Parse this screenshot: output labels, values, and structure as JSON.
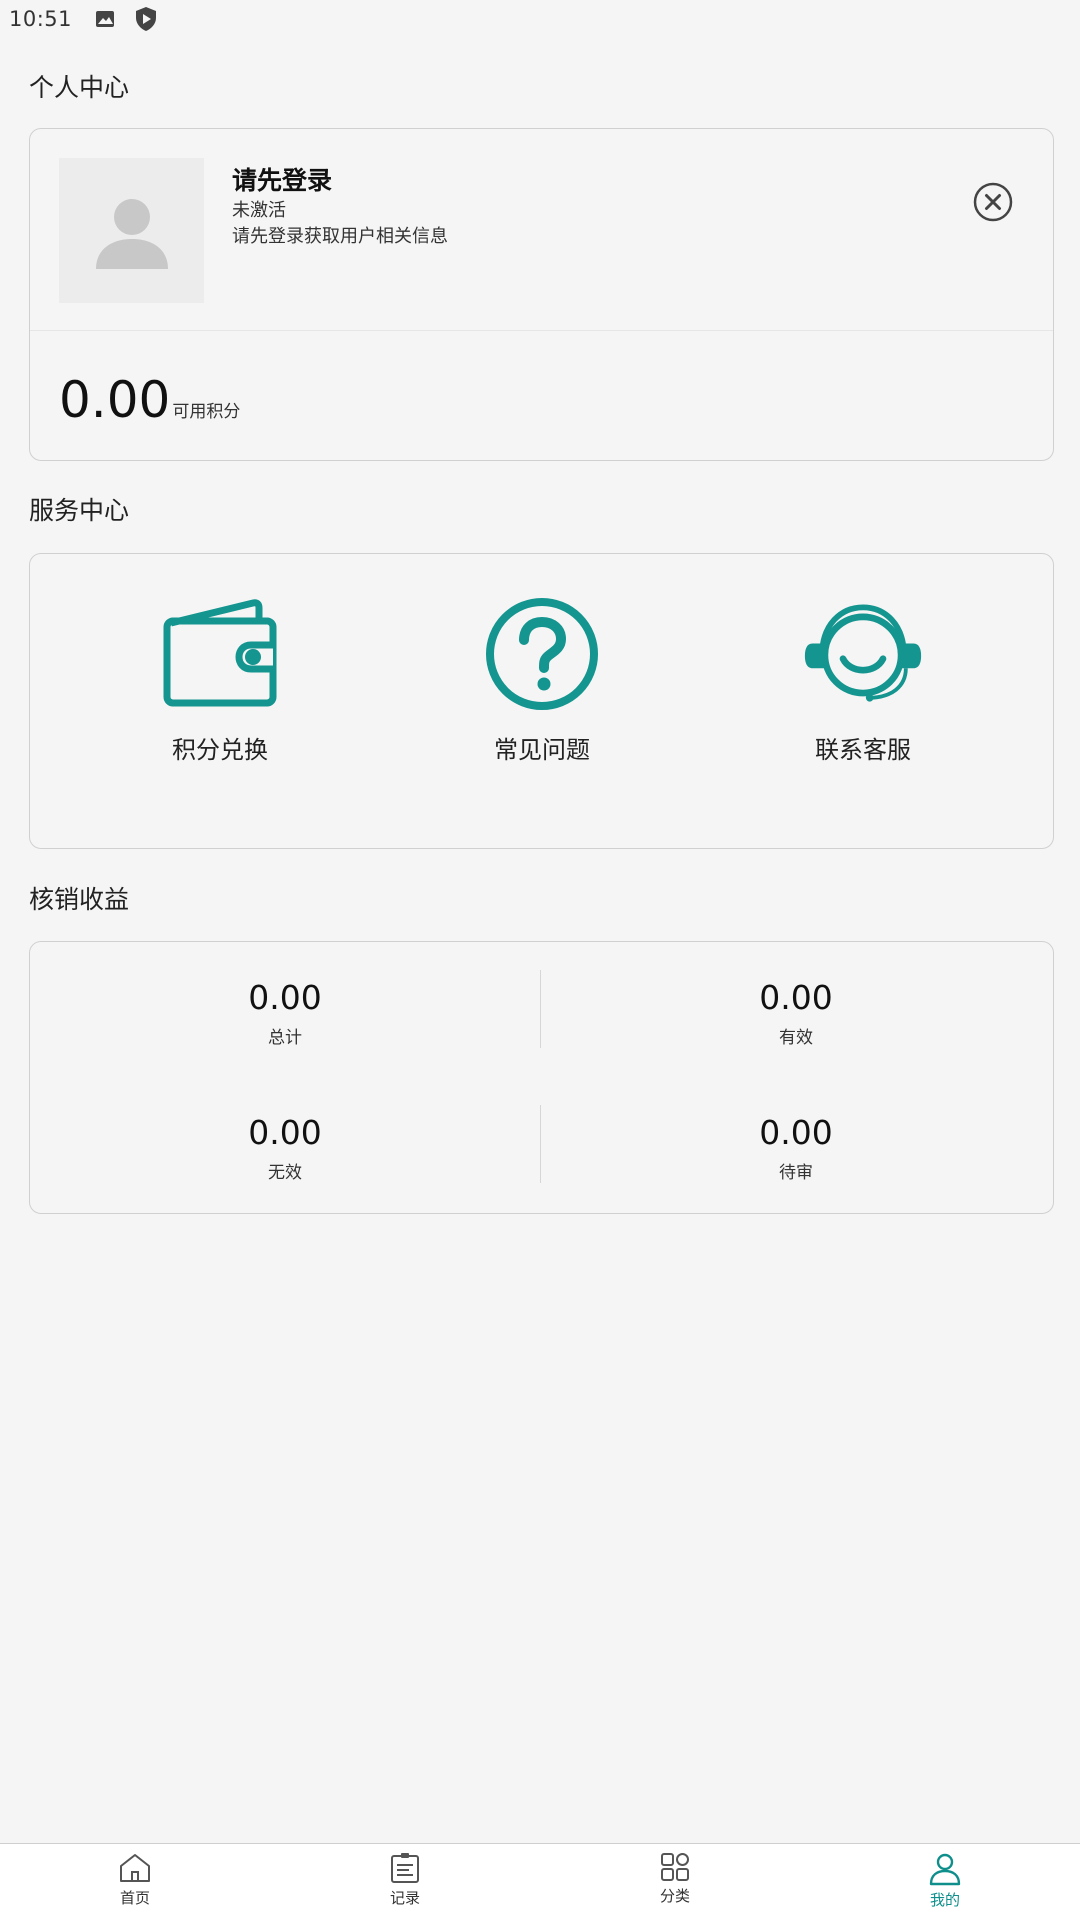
{
  "status_bar": {
    "time": "10:51"
  },
  "sections": {
    "personal": "个人中心",
    "services": "服务中心",
    "earnings": "核销收益"
  },
  "profile": {
    "title": "请先登录",
    "status": "未激活",
    "hint": "请先登录获取用户相关信息",
    "points_value": "0.00",
    "points_label": "可用积分"
  },
  "services": [
    {
      "label": "积分兑换",
      "icon": "wallet-icon"
    },
    {
      "label": "常见问题",
      "icon": "question-circle-icon"
    },
    {
      "label": "联系客服",
      "icon": "customer-service-headset-icon"
    }
  ],
  "earnings": [
    {
      "value": "0.00",
      "label": "总计"
    },
    {
      "value": "0.00",
      "label": "有效"
    },
    {
      "value": "0.00",
      "label": "无效"
    },
    {
      "value": "0.00",
      "label": "待审"
    }
  ],
  "bottom_nav": [
    {
      "label": "首页",
      "icon": "home-icon",
      "active": false
    },
    {
      "label": "记录",
      "icon": "clipboard-icon",
      "active": false
    },
    {
      "label": "分类",
      "icon": "grid-icon",
      "active": false
    },
    {
      "label": "我的",
      "icon": "user-icon",
      "active": true
    }
  ],
  "colors": {
    "accent": "#0f8f8b",
    "background": "#f5f5f5",
    "border": "#d0d0d0"
  }
}
